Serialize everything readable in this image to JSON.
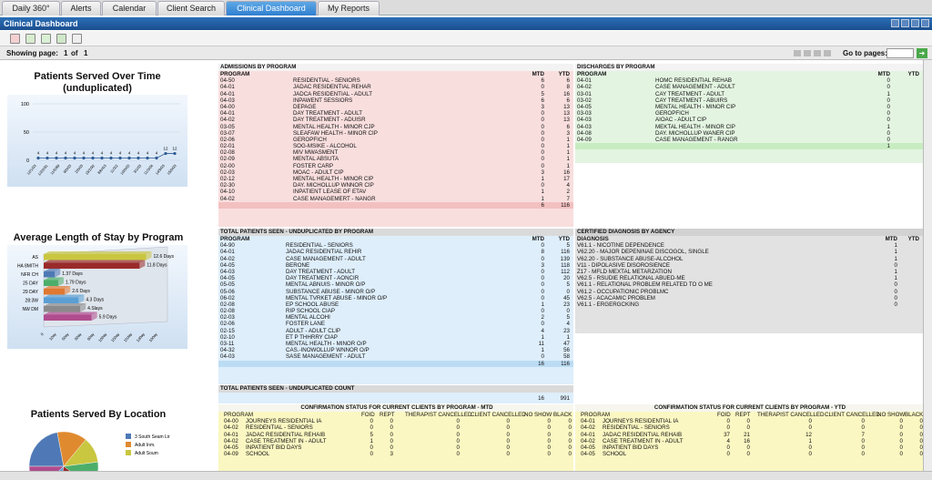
{
  "tabs": [
    "Daily 360°",
    "Alerts",
    "Calendar",
    "Client Search",
    "Clinical Dashboard",
    "My Reports"
  ],
  "window_title": "Clinical Dashboard",
  "pager": {
    "showing_label": "Showing page:",
    "page": "1",
    "of_label": "of",
    "total": "1",
    "goto_label": "Go to pages:",
    "go_button": "➜"
  },
  "left": {
    "time_title_1": "Patients Served Over Time",
    "time_title_2": "(unduplicated)",
    "time_y_ticks": [
      "100",
      "50",
      "0"
    ],
    "time_points": [
      4,
      4,
      4,
      4,
      4,
      4,
      4,
      4,
      4,
      4,
      4,
      4,
      4,
      4,
      12,
      12
    ],
    "time_point_labels": [
      "4",
      "4",
      "4",
      "4",
      "4",
      "4",
      "4",
      "4",
      "4",
      "4",
      "4",
      "4",
      "4",
      "4",
      "12",
      "12"
    ],
    "time_x_labels": [
      "12/1/03",
      "1/2/2/91",
      "11/5/89",
      "9/0/03",
      "2/0/03",
      "15/2/92",
      "8/6/4/3",
      "11/3/2",
      "10/0/03",
      "3/1/03",
      "11/3/04",
      "14/9/03",
      "15/0/03"
    ],
    "los_title": "Average Length of Stay by Program",
    "los_bars": [
      {
        "label": "AS",
        "value": 12.6,
        "text": "12.6 Days",
        "color": "#c9c640"
      },
      {
        "label": "HA 8MITH",
        "value": 11.8,
        "text": "11.8 Days",
        "color": "#9a2b2b"
      },
      {
        "label": "NFR CH",
        "value": 1.37,
        "text": "1.37 Days",
        "color": "#4f79b6"
      },
      {
        "label": "25 DAY",
        "value": 1.79,
        "text": "1.79 Days",
        "color": "#4cae6a"
      },
      {
        "label": "29 DAY",
        "value": 2.6,
        "text": "2.6 Days",
        "color": "#e07830"
      },
      {
        "label": "28:3W",
        "value": 4.3,
        "text": "4.3 Days",
        "color": "#5a9fd4"
      },
      {
        "label": "NW DM",
        "value": 4.5,
        "text": "4.Slays",
        "color": "#8a8a8a"
      },
      {
        "label": "",
        "value": 5.9,
        "text": "5.9 Days",
        "color": "#b04c8e"
      }
    ],
    "los_x_labels": [
      "0",
      "10ay",
      "50ay",
      "50ay",
      "60ay",
      "100ay",
      "150ay",
      "15day",
      "1d0ay",
      "100ay"
    ],
    "loc_title": "Patients Served By Location",
    "loc_legend": [
      {
        "label": "3 South Seam Lir",
        "color": "#4f79b6"
      },
      {
        "label": "Adult Inm.",
        "color": "#e08a30"
      },
      {
        "label": "Adult Soum",
        "color": "#c9c640"
      }
    ]
  },
  "admissions": {
    "title": "ADMISSIONS BY PROGRAM",
    "cols": [
      "PROGRAM",
      "MTD",
      "YTD"
    ],
    "rows": [
      [
        "04-50",
        "RESIDENTIAL - SENIORS",
        "6",
        "6"
      ],
      [
        "04-01",
        "JADAC RESIDENTIAL REHAR",
        "0",
        "8"
      ],
      [
        "04-01",
        "JADCA RESIDENTIAL - ADULT",
        "5",
        "16"
      ],
      [
        "04-03",
        "INPAWENT SESSIORS",
        "6",
        "6"
      ],
      [
        "04-00",
        "DEPAGE",
        "3",
        "13"
      ],
      [
        "04-01",
        "DAY TREATMENT - ADULT",
        "0",
        "13"
      ],
      [
        "04-02",
        "DAY TREATMENT - ADUISR",
        "0",
        "13"
      ],
      [
        "03-05",
        "MENTAL HEALTH - MINOR CJP",
        "0",
        "6"
      ],
      [
        "03-07",
        "SLEAFAW HEALTH - MINOR CIP",
        "0",
        "3"
      ],
      [
        "02-06",
        "GEROPFICH",
        "0",
        "1"
      ],
      [
        "02-01",
        "SOG-MSIKE - ALCOHOL",
        "0",
        "1"
      ],
      [
        "02-08",
        "MIV MWASMENT",
        "0",
        "1"
      ],
      [
        "02-09",
        "MENTAL ABSUTA",
        "0",
        "1"
      ],
      [
        "02-00",
        "FOSTER CARP",
        "0",
        "1"
      ],
      [
        "02-03",
        "MOAC - ADULT CIP",
        "3",
        "16"
      ],
      [
        "02-12",
        "MENTAL HEALTH - MINOR CIP",
        "1",
        "17"
      ],
      [
        "02-30",
        "DAY. MICHOLLUP WNNOR CIP",
        "0",
        "4"
      ],
      [
        "04-10",
        "INPATIENT LEASE OF ETAV",
        "1",
        "2"
      ],
      [
        "04-02",
        "CASE MANAGEMERT - NANGR",
        "1",
        "7"
      ]
    ],
    "total": [
      "6",
      "116"
    ]
  },
  "discharges": {
    "title": "DISCHARGES BY PROGRAM",
    "cols": [
      "PROGRAM",
      "MTD",
      "YTD"
    ],
    "rows": [
      [
        "04-01",
        "HOMC RESIDENTIAL REHAB",
        "0"
      ],
      [
        "04-02",
        "CASE MANAGEMENT - ADULT",
        "0"
      ],
      [
        "03-01",
        "CAY TREATMENT - ADULT",
        "1"
      ],
      [
        "03-02",
        "CAY TREATMENT - ABUIRS",
        "0"
      ],
      [
        "04-05",
        "MENTAL HEALTH - MINOR CIP",
        "0"
      ],
      [
        "03-03",
        "GEROPFICH",
        "0"
      ],
      [
        "04-03",
        "AIOAC - ADULT CIP",
        "0"
      ],
      [
        "04-03",
        "MEKTAL HEALTH - MINOR CIP",
        "1"
      ],
      [
        "04-08",
        "DAY. MICHOLLUP WANER CIP",
        "0"
      ],
      [
        "04-09",
        "CASE MANAGEMENT - RANGR",
        "0"
      ]
    ],
    "total": [
      "1"
    ]
  },
  "seen": {
    "title": "TOTAL PATIENTS SEEN - UNDUPLICATED BY PROGRAM",
    "cols": [
      "PROGRAM",
      "MTD",
      "YTD"
    ],
    "rows": [
      [
        "04-90",
        "RESIDENTIAL - SENIORS",
        "0",
        "5"
      ],
      [
        "04-01",
        "JADAC RESIDENTIAL REHIR",
        "8",
        "116"
      ],
      [
        "04-02",
        "CASE MANAGEMENT - ADULT",
        "0",
        "139"
      ],
      [
        "04-05",
        "BERONE",
        "3",
        "118"
      ],
      [
        "04-03",
        "DAY TREATMENT - ADULT",
        "0",
        "112"
      ],
      [
        "04-05",
        "DAY TREATMENT - AONCIR",
        "0",
        "20"
      ],
      [
        "05-05",
        "MENTAL ABNUIS - MINOR O/P",
        "0",
        "5"
      ],
      [
        "05-06",
        "SUBSTANCE ABUSE - MINOR O/P",
        "0",
        "0"
      ],
      [
        "06-02",
        "MENTAL TVRKET ABUSE - MINOR O/P",
        "0",
        "45"
      ],
      [
        "02-08",
        "EP SCHOOL ABUSE",
        "1",
        "23"
      ],
      [
        "02-08",
        "RIP SCHOOL CIAP",
        "0",
        "0"
      ],
      [
        "02-03",
        "MENTAL ALCOHI",
        "2",
        "5"
      ],
      [
        "02-06",
        "FOSTER LANE",
        "0",
        "4"
      ],
      [
        "02-15",
        "ADULT - ADULT CLIP",
        "4",
        "23"
      ],
      [
        "02-10",
        "ET P THHRRY CIAP",
        "1",
        "1"
      ],
      [
        "03-11",
        "MENTAL HEALTH - MINOR O/P",
        "11",
        "47"
      ],
      [
        "04-32",
        "CAS.-INOWOLLUP WNNOR O/P",
        "1",
        "56"
      ],
      [
        "04-03",
        "SASE MANAGEMENT - ADULT",
        "0",
        "58"
      ]
    ],
    "total": [
      "16",
      "116"
    ]
  },
  "unique": {
    "title": "TOTAL PATIENTS SEEN - UNDUPLICATED COUNT",
    "total": [
      "16",
      "991"
    ]
  },
  "diagnosis": {
    "title": "CERTIFIED DIAGNOSIS BY AGENCY",
    "cols": [
      "DIAGNOSIS",
      "MTD",
      "YTD"
    ],
    "rows": [
      [
        "V61.1 - NICOTINE DEPENDENCE",
        "1"
      ],
      [
        "V62.20 - MAJOR DEPENINAE DISCOGOL, SINGLE",
        "1"
      ],
      [
        "V62.20 - SUBSTANCE ABUSE-ALCOHOL",
        "1"
      ],
      [
        "V11 - DIPOLASIVE DISOROSIENCE",
        "0"
      ],
      [
        "Z17 - MFLD MEXTAL METARZATION",
        "1"
      ],
      [
        "V62.5 - RSUDIE RELATIONAL ABUED-ME",
        "1"
      ],
      [
        "V61.1 - RELATIONAL PROBLEM RELATED TO O ME",
        "0"
      ],
      [
        "V61.2 - OCCUPATIONIC PROBLMC",
        "0"
      ],
      [
        "V62.5 - ACACAMIC PROBLEM",
        "0"
      ],
      [
        "V61.1 - ERGERGCKING",
        "0"
      ]
    ]
  },
  "confirm_mtd": {
    "title": "CONFIRMATION STATUS FOR CURRENT CLIENTS BY PROGRAM - MTD",
    "cols": [
      "PROGRAM",
      "FOID",
      "REPT",
      "THERAPIST CANCELLED",
      "CLIENT CANCELLED",
      "NO SHOW",
      "BLACK"
    ],
    "rows": [
      [
        "04-00",
        "JOURNEYS RESIDENTIAL IA",
        "0",
        "0",
        "0",
        "0",
        "0",
        "0"
      ],
      [
        "04-02",
        "RESIDENTIAL - SENIORS",
        "0",
        "0",
        "0",
        "0",
        "0",
        "0"
      ],
      [
        "04-01",
        "JADAC RESIDENTIAL REHAIB",
        "5",
        "0",
        "0",
        "0",
        "0",
        "0"
      ],
      [
        "04-02",
        "CASE TREATMENT IN - ADULT",
        "1",
        "0",
        "0",
        "0",
        "0",
        "0"
      ],
      [
        "04-05",
        "INPATIENT BID DAYS",
        "0",
        "0",
        "0",
        "0",
        "0",
        "0"
      ],
      [
        "04-09",
        "SCHOOL",
        "0",
        "3",
        "0",
        "0",
        "0",
        "0"
      ]
    ]
  },
  "confirm_ytd": {
    "title": "CONFIRMATION STATUS FOR CURRENT CLIENTS BY PROGRAM - YTD",
    "cols": [
      "PROGRAM",
      "FOID",
      "REPT",
      "THERAPIST CANCELLED",
      "CLIENT CANCELLED",
      "NO SHOW",
      "BLACK"
    ],
    "rows": [
      [
        "04-01",
        "JOURNEYS RESIDENTIAL IA",
        "0",
        "0",
        "0",
        "0",
        "0",
        "0"
      ],
      [
        "04-02",
        "RESIDENTIAL - SENIORS",
        "0",
        "0",
        "0",
        "0",
        "0",
        "0"
      ],
      [
        "04-01",
        "JADAC RESIDENTIAL REHAIB",
        "37",
        "21",
        "12",
        "7",
        "0",
        "0"
      ],
      [
        "04-02",
        "CASE TREATMENT IN - ADULT",
        "4",
        "16",
        "1",
        "0",
        "0",
        "0"
      ],
      [
        "04-05",
        "INPATIENT BID DAYS",
        "0",
        "0",
        "0",
        "0",
        "0",
        "0"
      ],
      [
        "04-05",
        "SCHOOL",
        "0",
        "0",
        "0",
        "0",
        "0",
        "0"
      ]
    ]
  }
}
